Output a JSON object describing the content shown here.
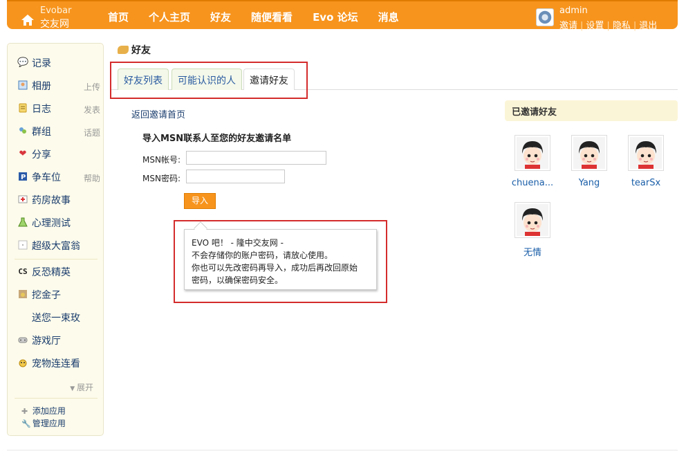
{
  "header": {
    "brand_line1": "Evobar",
    "brand_line2": "交友网",
    "nav": [
      "首页",
      "个人主页",
      "好友",
      "随便看看",
      "Evo 论坛",
      "消息"
    ],
    "username": "admin",
    "links": [
      "邀请",
      "设置",
      "隐私",
      "退出"
    ],
    "colors": {
      "bar": "#f7941d"
    }
  },
  "sidebar": {
    "items": [
      {
        "label": "记录",
        "sub": "",
        "icon": "speech-bubble-icon"
      },
      {
        "label": "相册",
        "sub": "上传",
        "icon": "photo-icon"
      },
      {
        "label": "日志",
        "sub": "发表",
        "icon": "notepad-icon"
      },
      {
        "label": "群组",
        "sub": "话题",
        "icon": "group-icon"
      },
      {
        "label": "分享",
        "sub": "",
        "icon": "hearts-icon"
      },
      {
        "label": "争车位",
        "sub": "帮助",
        "icon": "parking-icon"
      },
      {
        "label": "药房故事",
        "sub": "",
        "icon": "medicine-icon"
      },
      {
        "label": "心理测试",
        "sub": "",
        "icon": "flask-icon"
      },
      {
        "label": "超级大富翁",
        "sub": "",
        "icon": "blank-app-icon"
      },
      {
        "label": "反恐精英",
        "sub": "",
        "icon": "cs-icon"
      },
      {
        "label": "挖金子",
        "sub": "",
        "icon": "gold-icon"
      },
      {
        "label": "送您一束玫",
        "sub": "",
        "icon": ""
      },
      {
        "label": "游戏厅",
        "sub": "",
        "icon": "gamepad-icon"
      },
      {
        "label": "宠物连连看",
        "sub": "",
        "icon": "pet-icon"
      }
    ],
    "expand": "展开",
    "add_app": "添加应用",
    "manage_app": "管理应用"
  },
  "main": {
    "title": "好友",
    "tabs": [
      "好友列表",
      "可能认识的人",
      "邀请好友"
    ],
    "back_link": "返回邀请首页",
    "form_title": "导入MSN联系人至您的好友邀请名单",
    "msn_account_label": "MSN帐号:",
    "msn_password_label": "MSN密码:",
    "import_button": "导入",
    "tip_lines": [
      "EVO 吧！ - 隆中交友网 -",
      "不会存储你的账户密码，请放心使用。",
      "你也可以先改密码再导入，成功后再改回原始",
      "密码，以确保密码安全。"
    ]
  },
  "invited": {
    "title": "已邀请好友",
    "friends": [
      "chuena...",
      "Yang",
      "tearSx",
      "无情"
    ]
  }
}
